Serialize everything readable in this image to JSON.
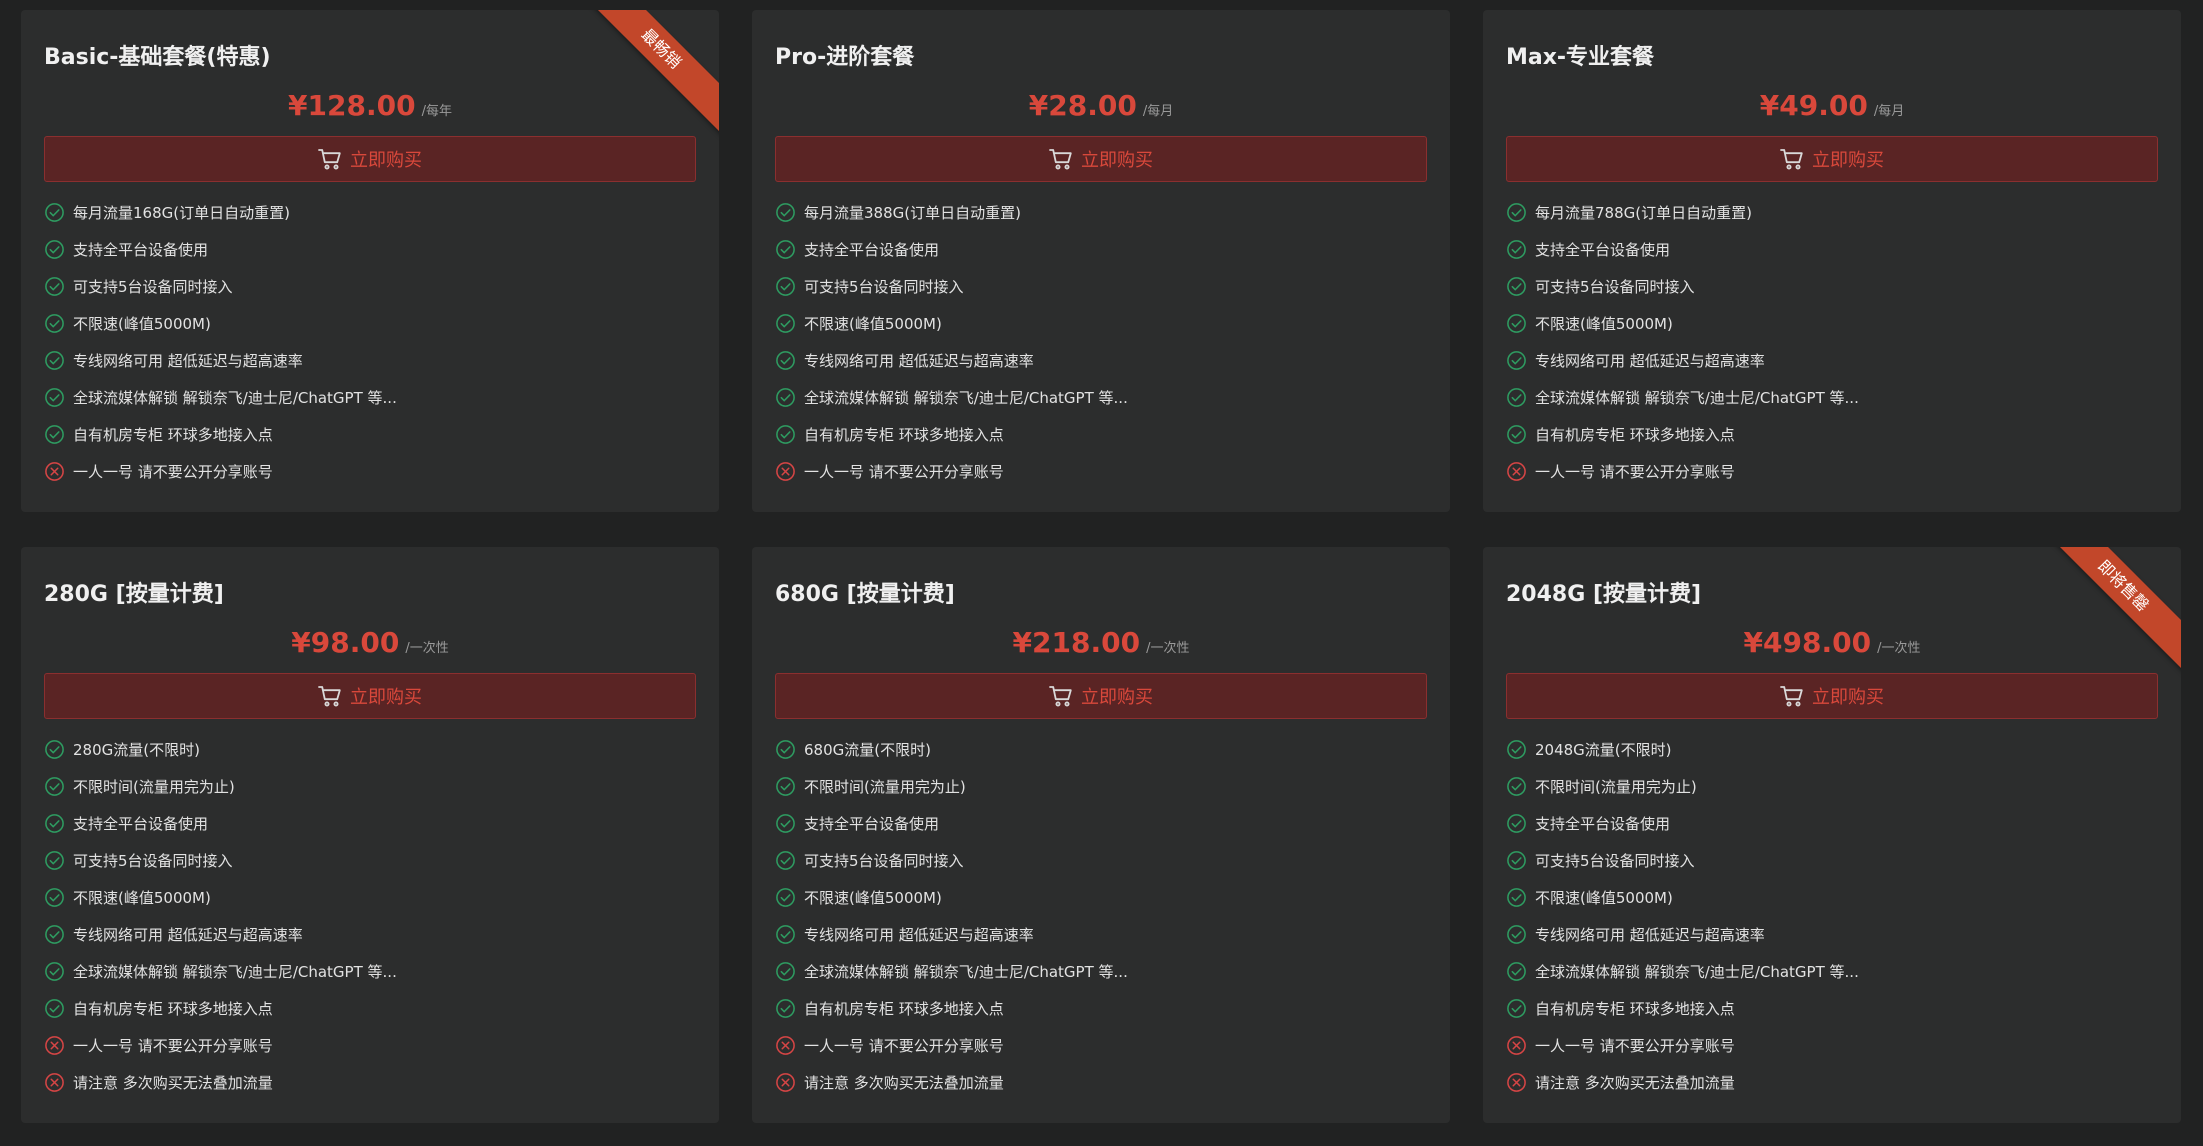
{
  "buy_label": "立即购买",
  "colors": {
    "background": "#212222",
    "card": "#2c2d2d",
    "accent": "#d9483b",
    "button_bg": "#5a2424",
    "check": "#2e9c61",
    "cross": "#d64545",
    "ribbon": "#c2472a"
  },
  "plans": [
    {
      "title": "Basic-基础套餐(特惠)",
      "price": "¥128.00",
      "period": "/每年",
      "ribbon": "最畅销",
      "features": [
        {
          "text": "每月流量168G(订单日自动重置)",
          "ok": true
        },
        {
          "text": "支持全平台设备使用",
          "ok": true
        },
        {
          "text": "可支持5台设备同时接入",
          "ok": true
        },
        {
          "text": "不限速(峰值5000M)",
          "ok": true
        },
        {
          "text": "专线网络可用 超低延迟与超高速率",
          "ok": true
        },
        {
          "text": "全球流媒体解锁 解锁奈飞/迪士尼/ChatGPT 等...",
          "ok": true
        },
        {
          "text": "自有机房专柜 环球多地接入点",
          "ok": true
        },
        {
          "text": "一人一号 请不要公开分享账号",
          "ok": false
        }
      ]
    },
    {
      "title": "Pro-进阶套餐",
      "price": "¥28.00",
      "period": "/每月",
      "ribbon": "",
      "features": [
        {
          "text": "每月流量388G(订单日自动重置)",
          "ok": true
        },
        {
          "text": "支持全平台设备使用",
          "ok": true
        },
        {
          "text": "可支持5台设备同时接入",
          "ok": true
        },
        {
          "text": "不限速(峰值5000M)",
          "ok": true
        },
        {
          "text": "专线网络可用 超低延迟与超高速率",
          "ok": true
        },
        {
          "text": "全球流媒体解锁 解锁奈飞/迪士尼/ChatGPT 等...",
          "ok": true
        },
        {
          "text": "自有机房专柜 环球多地接入点",
          "ok": true
        },
        {
          "text": "一人一号 请不要公开分享账号",
          "ok": false
        }
      ]
    },
    {
      "title": "Max-专业套餐",
      "price": "¥49.00",
      "period": "/每月",
      "ribbon": "",
      "features": [
        {
          "text": "每月流量788G(订单日自动重置)",
          "ok": true
        },
        {
          "text": "支持全平台设备使用",
          "ok": true
        },
        {
          "text": "可支持5台设备同时接入",
          "ok": true
        },
        {
          "text": "不限速(峰值5000M)",
          "ok": true
        },
        {
          "text": "专线网络可用 超低延迟与超高速率",
          "ok": true
        },
        {
          "text": "全球流媒体解锁 解锁奈飞/迪士尼/ChatGPT 等...",
          "ok": true
        },
        {
          "text": "自有机房专柜 环球多地接入点",
          "ok": true
        },
        {
          "text": "一人一号 请不要公开分享账号",
          "ok": false
        }
      ]
    },
    {
      "title": "280G [按量计费]",
      "price": "¥98.00",
      "period": "/一次性",
      "ribbon": "",
      "features": [
        {
          "text": "280G流量(不限时)",
          "ok": true
        },
        {
          "text": "不限时间(流量用完为止)",
          "ok": true
        },
        {
          "text": "支持全平台设备使用",
          "ok": true
        },
        {
          "text": "可支持5台设备同时接入",
          "ok": true
        },
        {
          "text": "不限速(峰值5000M)",
          "ok": true
        },
        {
          "text": "专线网络可用 超低延迟与超高速率",
          "ok": true
        },
        {
          "text": "全球流媒体解锁 解锁奈飞/迪士尼/ChatGPT 等...",
          "ok": true
        },
        {
          "text": "自有机房专柜 环球多地接入点",
          "ok": true
        },
        {
          "text": "一人一号 请不要公开分享账号",
          "ok": false
        },
        {
          "text": "请注意 多次购买无法叠加流量",
          "ok": false
        }
      ]
    },
    {
      "title": "680G [按量计费]",
      "price": "¥218.00",
      "period": "/一次性",
      "ribbon": "",
      "features": [
        {
          "text": "680G流量(不限时)",
          "ok": true
        },
        {
          "text": "不限时间(流量用完为止)",
          "ok": true
        },
        {
          "text": "支持全平台设备使用",
          "ok": true
        },
        {
          "text": "可支持5台设备同时接入",
          "ok": true
        },
        {
          "text": "不限速(峰值5000M)",
          "ok": true
        },
        {
          "text": "专线网络可用 超低延迟与超高速率",
          "ok": true
        },
        {
          "text": "全球流媒体解锁 解锁奈飞/迪士尼/ChatGPT 等...",
          "ok": true
        },
        {
          "text": "自有机房专柜 环球多地接入点",
          "ok": true
        },
        {
          "text": "一人一号 请不要公开分享账号",
          "ok": false
        },
        {
          "text": "请注意 多次购买无法叠加流量",
          "ok": false
        }
      ]
    },
    {
      "title": "2048G [按量计费]",
      "price": "¥498.00",
      "period": "/一次性",
      "ribbon": "即将售罄",
      "features": [
        {
          "text": "2048G流量(不限时)",
          "ok": true
        },
        {
          "text": "不限时间(流量用完为止)",
          "ok": true
        },
        {
          "text": "支持全平台设备使用",
          "ok": true
        },
        {
          "text": "可支持5台设备同时接入",
          "ok": true
        },
        {
          "text": "不限速(峰值5000M)",
          "ok": true
        },
        {
          "text": "专线网络可用 超低延迟与超高速率",
          "ok": true
        },
        {
          "text": "全球流媒体解锁 解锁奈飞/迪士尼/ChatGPT 等...",
          "ok": true
        },
        {
          "text": "自有机房专柜 环球多地接入点",
          "ok": true
        },
        {
          "text": "一人一号 请不要公开分享账号",
          "ok": false
        },
        {
          "text": "请注意 多次购买无法叠加流量",
          "ok": false
        }
      ]
    }
  ]
}
